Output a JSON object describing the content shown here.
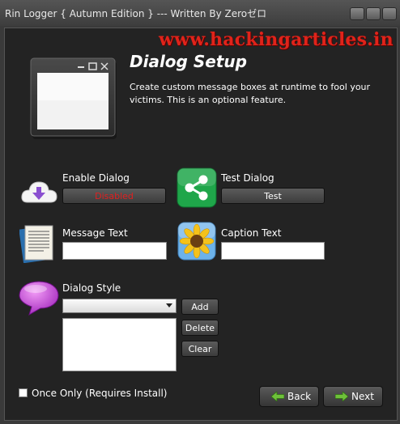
{
  "window": {
    "title": "Rin Logger  { Autumn Edition } --- Written By Zeroゼロ"
  },
  "watermark": "www.hackingarticles.in",
  "header": {
    "title": "Dialog Setup",
    "description": "Create custom message boxes at runtime to fool your victims. This is an optional feature."
  },
  "enable_dialog": {
    "label": "Enable Dialog",
    "button_label": "Disabled",
    "button_color": "#e02020"
  },
  "test_dialog": {
    "label": "Test Dialog",
    "button_label": "Test"
  },
  "message_text": {
    "label": "Message Text",
    "value": ""
  },
  "caption_text": {
    "label": "Caption Text",
    "value": ""
  },
  "dialog_style": {
    "label": "Dialog Style",
    "selected": "",
    "add_label": "Add",
    "delete_label": "Delete",
    "clear_label": "Clear",
    "items": []
  },
  "once_only": {
    "label": "Once Only (Requires Install)",
    "checked": false
  },
  "footer": {
    "back_label": "Back",
    "next_label": "Next"
  },
  "icons": {
    "minimize": "window-button-icon",
    "maximize": "window-button-icon",
    "close": "window-button-icon",
    "dialog": "dialog-window-icon",
    "enable": "cloud-download-icon",
    "test": "share-icon",
    "message": "document-icon",
    "caption": "sunflower-icon",
    "style": "speech-bubble-icon",
    "back": "arrow-left-icon",
    "next": "arrow-right-icon"
  }
}
